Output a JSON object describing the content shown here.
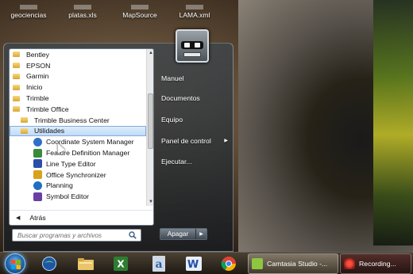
{
  "desktop": {
    "icons": [
      {
        "label": "geociencias"
      },
      {
        "label": "platas.xls"
      },
      {
        "label": "MapSource"
      },
      {
        "label": "LAMA.xml"
      }
    ]
  },
  "start_menu": {
    "programs": [
      {
        "label": "Bentley",
        "kind": "folder"
      },
      {
        "label": "EPSON",
        "kind": "folder"
      },
      {
        "label": "Garmin",
        "kind": "folder"
      },
      {
        "label": "Inicio",
        "kind": "folder"
      },
      {
        "label": "Trimble",
        "kind": "folder"
      },
      {
        "label": "Trimble Office",
        "kind": "folder"
      },
      {
        "label": "Trimble Business Center",
        "kind": "folder"
      },
      {
        "label": "Utilidades",
        "kind": "folder"
      },
      {
        "label": "Coordinate System Manager",
        "kind": "app",
        "icon": "globe-icon",
        "color": "#2d6fc8"
      },
      {
        "label": "Feature Definition Manager",
        "kind": "app",
        "icon": "feature-icon",
        "color": "#3a8a3a"
      },
      {
        "label": "Line Type Editor",
        "kind": "app",
        "icon": "line-type-icon",
        "color": "#2b4fa8"
      },
      {
        "label": "Office Synchronizer",
        "kind": "app",
        "icon": "sync-icon",
        "color": "#d7a21c"
      },
      {
        "label": "Planning",
        "kind": "app",
        "icon": "planning-icon",
        "color": "#1f6ec4"
      },
      {
        "label": "Symbol Editor",
        "kind": "app",
        "icon": "symbol-icon",
        "color": "#6a3fa2"
      }
    ],
    "back_label": "Atrás",
    "search_placeholder": "Buscar programas y archivos",
    "right_items": [
      "Manuel",
      "Documentos",
      "Equipo",
      "Panel de control",
      "Ejecutar..."
    ],
    "shutdown_label": "Apagar"
  },
  "taskbar": {
    "tasks": [
      {
        "label": "Camtasia Studio -..."
      },
      {
        "label": "Recording..."
      }
    ]
  },
  "colors": {
    "highlight": "#c1dcf7",
    "orb": "#2a6fb7"
  }
}
